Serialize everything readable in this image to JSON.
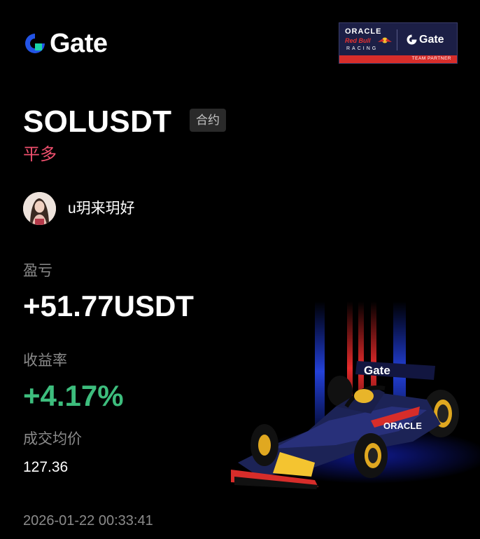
{
  "brand": {
    "name": "Gate",
    "accent": "#2354e6"
  },
  "partner_badge": {
    "oracle": "ORACLE",
    "red_bull": "Red Bull",
    "racing": "RACING",
    "gate": "Gate",
    "team_partner": "TEAM PARTNER",
    "strip_color": "#d72d2a"
  },
  "trade": {
    "pair": "SOLUSDT",
    "type_badge": "合约",
    "direction": "平多",
    "direction_color": "#f0506e"
  },
  "user": {
    "name": "u玥来玥好",
    "avatar_icon": "avatar-photo"
  },
  "pnl": {
    "label": "盈亏",
    "value": "+51.77USDT"
  },
  "yield": {
    "label": "收益率",
    "value": "+4.17%",
    "color": "#3dbd7d"
  },
  "avg_price": {
    "label": "成交均价",
    "value": "127.36"
  },
  "timestamp": "2026-01-22 00:33:41",
  "illustration": {
    "icon": "f1-race-car",
    "livery": "Oracle Red Bull Racing / Gate"
  }
}
